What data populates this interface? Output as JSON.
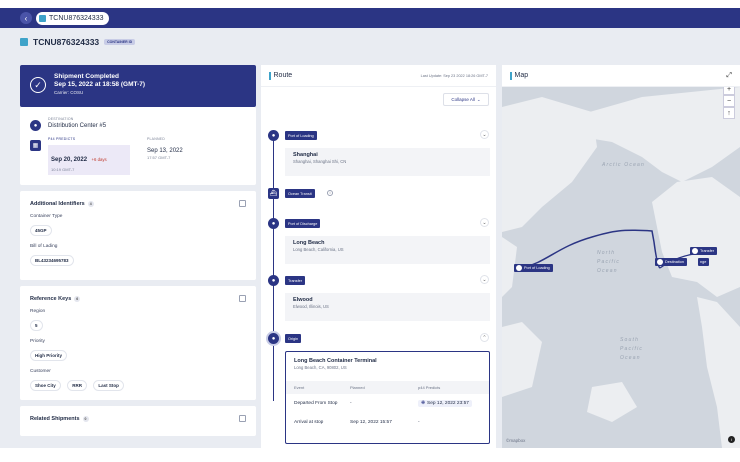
{
  "tab": {
    "label": "TCNU876324333"
  },
  "page": {
    "title": "TCNU876324333",
    "tag": "CONTAINER ID"
  },
  "status": {
    "title": "Shipment Completed",
    "datetime": "Sep 15, 2022 at 18:58 (GMT-7)",
    "carrier": "Carrier: COSU"
  },
  "destination": {
    "label": "DESTINATION",
    "name": "Distribution Center #5",
    "predicts_label": "p44 PREDICTS",
    "predicted_date": "Sep 20, 2022",
    "predicted_delta": "+6 days",
    "predicted_time": "10:19 GMT-7",
    "planned_label": "PLANNED",
    "planned_date": "Sep 13, 2022",
    "planned_time": "17:57 GMT-7"
  },
  "identifiers": {
    "title": "Additional Identifiers",
    "count": "4",
    "container_type_label": "Container Type",
    "container_type": "45GP",
    "bol_label": "Bill of Lading",
    "bol": "BL43234695783"
  },
  "reference_keys": {
    "title": "Reference Keys",
    "count": "6",
    "region_label": "Region",
    "region": "5",
    "priority_label": "Priority",
    "priority": "High Priority",
    "customer_label": "Customer",
    "customers": [
      "Shoe City",
      "RRR",
      "Last Stop"
    ]
  },
  "related": {
    "title": "Related Shipments",
    "count": "0"
  },
  "route": {
    "title": "Route",
    "last_update": "Last Update: Sep 23 2022 18:26 GMT-7",
    "collapse": "Collapse All",
    "stops": [
      {
        "badge": "Port of Loading",
        "name": "Shanghai",
        "sub": "Shanghai, Shanghai Shi, CN"
      },
      {
        "badge": "Ocean Transit"
      },
      {
        "badge": "Port of Discharge",
        "name": "Long Beach",
        "sub": "Long Beach, California, US"
      },
      {
        "badge": "Transfer",
        "name": "Elwood",
        "sub": "Elwood, Illinois, US"
      },
      {
        "badge": "Origin"
      }
    ],
    "terminal": {
      "name": "Long Beach Container Terminal",
      "address": "Long Beach, CA, 90802, US",
      "columns": [
        "Event",
        "Planned",
        "p44 Predicts"
      ],
      "rows": [
        {
          "event": "Departed From Stop",
          "planned": "-",
          "predicts": "Sep 12, 2022 23:57"
        },
        {
          "event": "Arrival at stop",
          "planned": "Sep 12, 2022 15:57",
          "predicts": "-"
        }
      ]
    }
  },
  "map": {
    "title": "Map",
    "labels": {
      "transfer": "Transfer",
      "loading": "Port of Loading",
      "destination": "Destination",
      "destination_tail": "nge"
    },
    "oceans": {
      "arctic": "Arctic Ocean",
      "north1": "North",
      "north2": "Pacific",
      "north3": "Ocean",
      "south1": "South",
      "south2": "Pacific",
      "south3": "Ocean"
    },
    "attribution": "©mapbox"
  },
  "colors": {
    "brand": "#2b3584",
    "accent": "#3fa3c9",
    "bg": "#e9ecf2"
  }
}
